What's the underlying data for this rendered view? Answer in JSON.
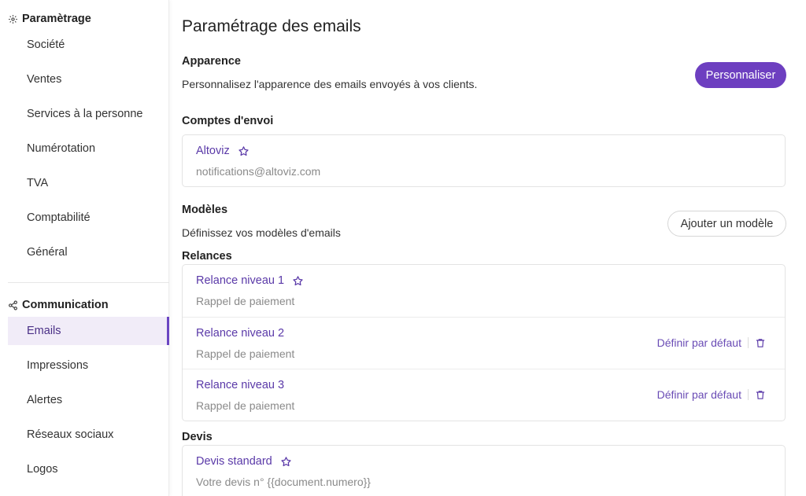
{
  "sidebar": {
    "section1_title": "Paramètrage",
    "section1_items": [
      {
        "label": "Société"
      },
      {
        "label": "Ventes"
      },
      {
        "label": "Services à la personne"
      },
      {
        "label": "Numérotation"
      },
      {
        "label": "TVA"
      },
      {
        "label": "Comptabilité"
      },
      {
        "label": "Général"
      }
    ],
    "section2_title": "Communication",
    "section2_items": [
      {
        "label": "Emails",
        "active": true
      },
      {
        "label": "Impressions"
      },
      {
        "label": "Alertes"
      },
      {
        "label": "Réseaux sociaux"
      },
      {
        "label": "Logos"
      }
    ]
  },
  "main": {
    "title": "Paramétrage des emails",
    "apparence": {
      "title": "Apparence",
      "description": "Personnalisez l'apparence des emails envoyés à vos clients.",
      "button": "Personnaliser"
    },
    "comptes": {
      "title": "Comptes d'envoi",
      "account": {
        "name": "Altoviz",
        "email": "notifications@altoviz.com"
      }
    },
    "modeles": {
      "title": "Modèles",
      "description": "Définissez vos modèles d'emails",
      "button": "Ajouter un modèle"
    },
    "relances": {
      "title": "Relances",
      "items": [
        {
          "name": "Relance niveau 1",
          "subject": "Rappel de paiement"
        },
        {
          "name": "Relance niveau 2",
          "subject": "Rappel de paiement",
          "action": "Définir par défaut"
        },
        {
          "name": "Relance niveau 3",
          "subject": "Rappel de paiement",
          "action": "Définir par défaut"
        }
      ]
    },
    "devis": {
      "title": "Devis",
      "items": [
        {
          "name": "Devis standard",
          "subject": "Votre devis n° {{document.numero}}"
        }
      ]
    }
  },
  "colors": {
    "accent": "#6d3fc0",
    "link": "#5a39a8",
    "active_bg": "#f1ecf8"
  }
}
